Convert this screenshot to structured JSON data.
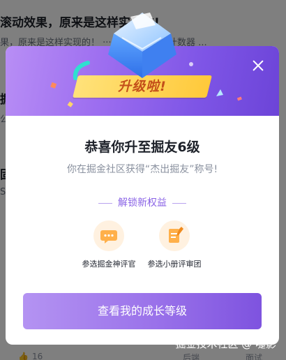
{
  "background": {
    "row1_title": "滚动效果，原来是这样实现的!",
    "row1_desc": "果，原来是这样实现的！ ·······首页种草的计数器 ...",
    "row2_title": "掘",
    "row2_desc": "公",
    "row3_title": "固",
    "row3_desc": "S",
    "footer_likes": "16",
    "footer_tag1": "后端",
    "footer_tag2": "面试"
  },
  "modal": {
    "badge": "升级啦!",
    "title": "恭喜你升至掘友6级",
    "subtitle": "你在掘金社区获得“杰出掘友”称号!",
    "unlock_label": "解锁新权益",
    "perks": [
      {
        "label": "参选掘金神评官",
        "icon": "chat-bubble-icon"
      },
      {
        "label": "参选小册评审团",
        "icon": "booklet-pen-icon"
      }
    ],
    "cta_label": "查看我的成长等级"
  },
  "watermark": "掘金技术社区 @ 嚏影",
  "colors": {
    "accent_purple": "#8a63e6",
    "badge_yellow": "#ffc93a",
    "badge_text": "#c4501a"
  }
}
